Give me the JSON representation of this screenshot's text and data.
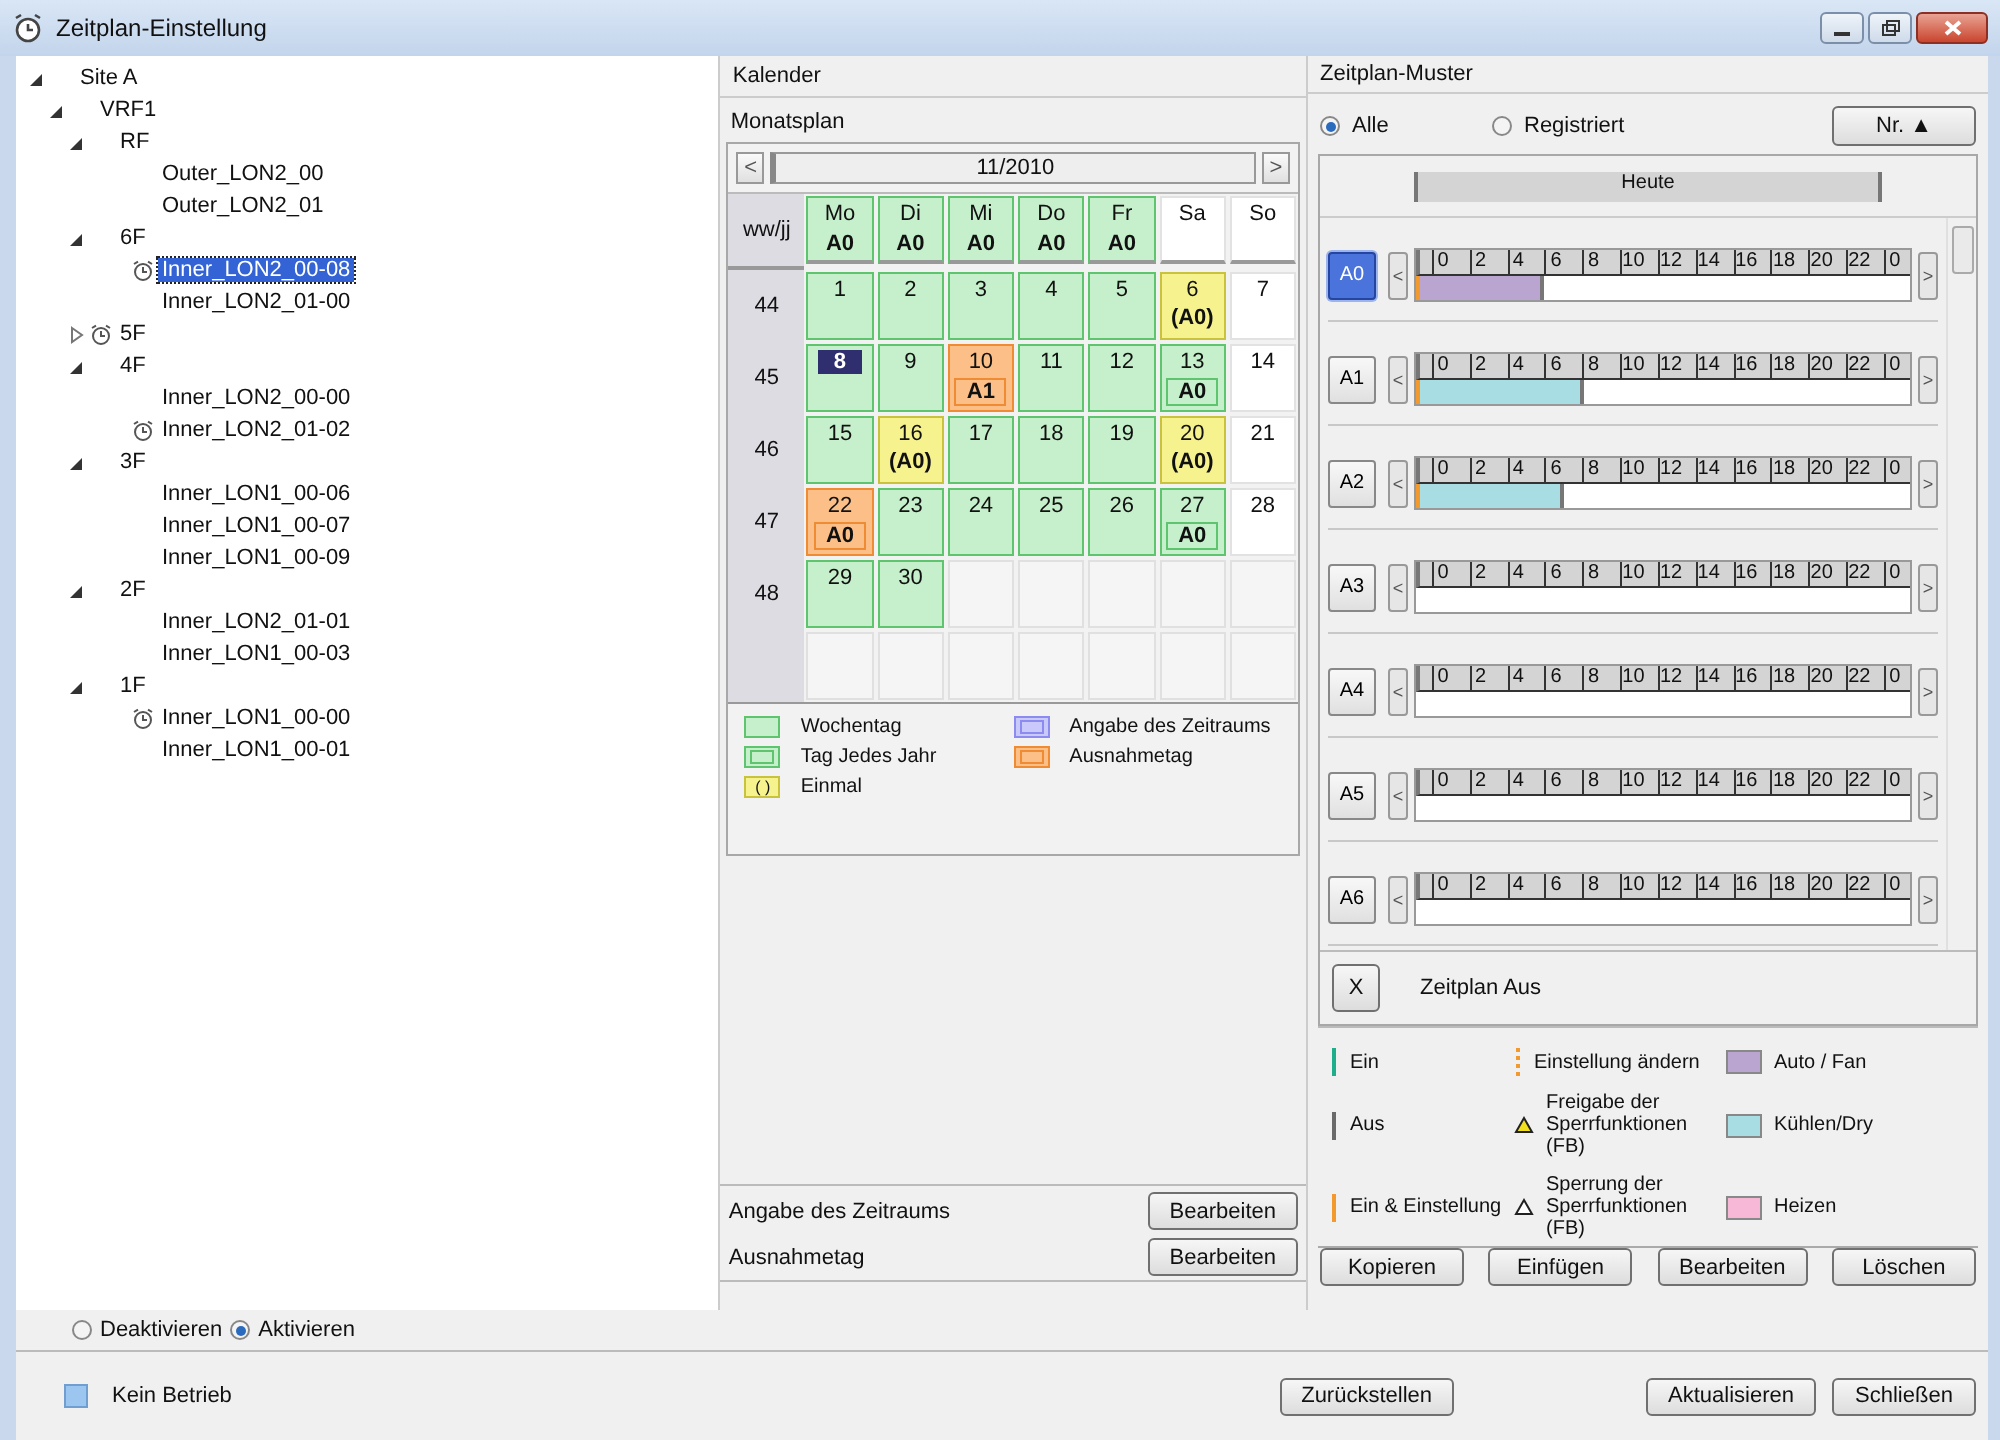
{
  "window": {
    "title": "Zeitplan-Einstellung"
  },
  "tree": [
    {
      "label": "Site A",
      "expanded": true,
      "schedule": false,
      "selected": false,
      "children": [
        {
          "label": "VRF1",
          "expanded": true,
          "schedule": false,
          "selected": false,
          "children": [
            {
              "label": "RF",
              "expanded": true,
              "schedule": false,
              "selected": false,
              "children": [
                {
                  "label": "Outer_LON2_00",
                  "schedule": false,
                  "selected": false
                },
                {
                  "label": "Outer_LON2_01",
                  "schedule": false,
                  "selected": false
                }
              ]
            },
            {
              "label": "6F",
              "expanded": true,
              "schedule": false,
              "selected": false,
              "children": [
                {
                  "label": "Inner_LON2_00-08",
                  "schedule": true,
                  "selected": true
                },
                {
                  "label": "Inner_LON2_01-00",
                  "schedule": false,
                  "selected": false
                }
              ]
            },
            {
              "label": "5F",
              "expanded": false,
              "schedule": true,
              "selected": false
            },
            {
              "label": "4F",
              "expanded": true,
              "schedule": false,
              "selected": false,
              "children": [
                {
                  "label": "Inner_LON2_00-00",
                  "schedule": false,
                  "selected": false
                },
                {
                  "label": "Inner_LON2_01-02",
                  "schedule": true,
                  "selected": false
                }
              ]
            },
            {
              "label": "3F",
              "expanded": true,
              "schedule": false,
              "selected": false,
              "children": [
                {
                  "label": "Inner_LON1_00-06",
                  "schedule": false,
                  "selected": false
                },
                {
                  "label": "Inner_LON1_00-07",
                  "schedule": false,
                  "selected": false
                },
                {
                  "label": "Inner_LON1_00-09",
                  "schedule": false,
                  "selected": false
                }
              ]
            },
            {
              "label": "2F",
              "expanded": true,
              "schedule": false,
              "selected": false,
              "children": [
                {
                  "label": "Inner_LON2_01-01",
                  "schedule": false,
                  "selected": false
                },
                {
                  "label": "Inner_LON1_00-03",
                  "schedule": false,
                  "selected": false
                }
              ]
            },
            {
              "label": "1F",
              "expanded": true,
              "schedule": false,
              "selected": false,
              "children": [
                {
                  "label": "Inner_LON1_00-00",
                  "schedule": true,
                  "selected": false
                },
                {
                  "label": "Inner_LON1_00-01",
                  "schedule": false,
                  "selected": false
                }
              ]
            }
          ]
        }
      ]
    }
  ],
  "activation": [
    {
      "label": "Deaktivieren",
      "selected": false
    },
    {
      "label": "Aktivieren",
      "selected": true
    }
  ],
  "calendar": {
    "title": "Kalender",
    "subtitle": "Monatsplan",
    "prev": "<",
    "month": "11/2010",
    "next": ">",
    "week_header": "ww/jj",
    "days": [
      {
        "label": "Mo",
        "pattern": "A0",
        "kind": "weekday"
      },
      {
        "label": "Di",
        "pattern": "A0",
        "kind": "weekday"
      },
      {
        "label": "Mi",
        "pattern": "A0",
        "kind": "weekday"
      },
      {
        "label": "Do",
        "pattern": "A0",
        "kind": "weekday"
      },
      {
        "label": "Fr",
        "pattern": "A0",
        "kind": "weekday"
      },
      {
        "label": "Sa",
        "kind": "plain"
      },
      {
        "label": "So",
        "kind": "plain"
      }
    ],
    "weeks": [
      {
        "number": "44",
        "cells": [
          {
            "day": "1",
            "kind": "weekday",
            "selected": false
          },
          {
            "day": "2",
            "kind": "weekday",
            "selected": false
          },
          {
            "day": "3",
            "kind": "weekday",
            "selected": false
          },
          {
            "day": "4",
            "kind": "weekday",
            "selected": false
          },
          {
            "day": "5",
            "kind": "weekday",
            "selected": false
          },
          {
            "day": "6",
            "pattern": "(A0)",
            "kind": "once",
            "selected": false
          },
          {
            "day": "7",
            "kind": "plain",
            "selected": false
          }
        ]
      },
      {
        "number": "45",
        "cells": [
          {
            "day": "8",
            "kind": "weekday",
            "selected": true
          },
          {
            "day": "9",
            "kind": "weekday",
            "selected": false
          },
          {
            "day": "10",
            "pattern": "A1",
            "kind": "exception",
            "selected": false
          },
          {
            "day": "11",
            "kind": "weekday",
            "selected": false
          },
          {
            "day": "12",
            "kind": "weekday",
            "selected": false
          },
          {
            "day": "13",
            "pattern": "A0",
            "kind": "yearly",
            "selected": false
          },
          {
            "day": "14",
            "kind": "plain",
            "selected": false
          }
        ]
      },
      {
        "number": "46",
        "cells": [
          {
            "day": "15",
            "kind": "weekday",
            "selected": false
          },
          {
            "day": "16",
            "pattern": "(A0)",
            "kind": "once",
            "selected": false
          },
          {
            "day": "17",
            "kind": "weekday",
            "selected": false
          },
          {
            "day": "18",
            "kind": "weekday",
            "selected": false
          },
          {
            "day": "19",
            "kind": "weekday",
            "selected": false
          },
          {
            "day": "20",
            "pattern": "(A0)",
            "kind": "once",
            "selected": false
          },
          {
            "day": "21",
            "kind": "plain",
            "selected": false
          }
        ]
      },
      {
        "number": "47",
        "cells": [
          {
            "day": "22",
            "pattern": "A0",
            "kind": "exception",
            "selected": false
          },
          {
            "day": "23",
            "kind": "weekday",
            "selected": false
          },
          {
            "day": "24",
            "kind": "weekday",
            "selected": false
          },
          {
            "day": "25",
            "kind": "weekday",
            "selected": false
          },
          {
            "day": "26",
            "kind": "weekday",
            "selected": false
          },
          {
            "day": "27",
            "pattern": "A0",
            "kind": "yearly",
            "selected": false
          },
          {
            "day": "28",
            "kind": "plain",
            "selected": false
          }
        ]
      },
      {
        "number": "48",
        "cells": [
          {
            "day": "29",
            "kind": "weekday",
            "selected": false
          },
          {
            "day": "30",
            "kind": "weekday",
            "selected": false
          },
          {
            "kind": "empty"
          },
          {
            "kind": "empty"
          },
          {
            "kind": "empty"
          },
          {
            "kind": "empty"
          },
          {
            "kind": "empty"
          }
        ]
      },
      {
        "cells": [
          {
            "kind": "empty"
          },
          {
            "kind": "empty"
          },
          {
            "kind": "empty"
          },
          {
            "kind": "empty"
          },
          {
            "kind": "empty"
          },
          {
            "kind": "empty"
          },
          {
            "kind": "empty"
          }
        ]
      }
    ],
    "legend": [
      {
        "label": "Wochentag",
        "kind": "weekday"
      },
      {
        "label": "Angabe des Zeitraums",
        "kind": "period"
      },
      {
        "label": "Tag Jedes Jahr",
        "kind": "yearly"
      },
      {
        "label": "Ausnahmetag",
        "kind": "exception"
      },
      {
        "label": "Einmal",
        "kind": "once",
        "symbol": "( )"
      }
    ],
    "footer": [
      {
        "label": "Angabe des Zeitraums",
        "button": "Bearbeiten"
      },
      {
        "label": "Ausnahmetag",
        "button": "Bearbeiten"
      }
    ]
  },
  "patterns": {
    "title": "Zeitplan-Muster",
    "filters": [
      {
        "label": "Alle",
        "selected": true
      },
      {
        "label": "Registriert",
        "selected": false
      }
    ],
    "sort_button": "Nr. ▲",
    "today_label": "Heute",
    "rows": [
      {
        "name": "A0",
        "selected": true,
        "prev": "<",
        "next": ">",
        "start_marker": true,
        "color": "#b9a5cf",
        "level": 0.25,
        "ticks": [
          "0",
          "2",
          "4",
          "6",
          "8",
          "10",
          "12",
          "14",
          "16",
          "18",
          "20",
          "22",
          "0"
        ]
      },
      {
        "name": "A1",
        "selected": false,
        "prev": "<",
        "next": ">",
        "start_marker": true,
        "color": "#a8dde3",
        "level": 0.333,
        "ticks": [
          "0",
          "2",
          "4",
          "6",
          "8",
          "10",
          "12",
          "14",
          "16",
          "18",
          "20",
          "22",
          "0"
        ]
      },
      {
        "name": "A2",
        "selected": false,
        "prev": "<",
        "next": ">",
        "start_marker": true,
        "color": "#a8dde3",
        "level": 0.292,
        "ticks": [
          "0",
          "2",
          "4",
          "6",
          "8",
          "10",
          "12",
          "14",
          "16",
          "18",
          "20",
          "22",
          "0"
        ]
      },
      {
        "name": "A3",
        "selected": false,
        "prev": "<",
        "next": ">",
        "start_marker": false,
        "ticks": [
          "0",
          "2",
          "4",
          "6",
          "8",
          "10",
          "12",
          "14",
          "16",
          "18",
          "20",
          "22",
          "0"
        ]
      },
      {
        "name": "A4",
        "selected": false,
        "prev": "<",
        "next": ">",
        "start_marker": false,
        "ticks": [
          "0",
          "2",
          "4",
          "6",
          "8",
          "10",
          "12",
          "14",
          "16",
          "18",
          "20",
          "22",
          "0"
        ]
      },
      {
        "name": "A5",
        "selected": false,
        "prev": "<",
        "next": ">",
        "start_marker": false,
        "ticks": [
          "0",
          "2",
          "4",
          "6",
          "8",
          "10",
          "12",
          "14",
          "16",
          "18",
          "20",
          "22",
          "0"
        ]
      },
      {
        "name": "A6",
        "selected": false,
        "prev": "<",
        "next": ">",
        "start_marker": false,
        "ticks": [
          "0",
          "2",
          "4",
          "6",
          "8",
          "10",
          "12",
          "14",
          "16",
          "18",
          "20",
          "22",
          "0"
        ]
      }
    ],
    "off_button": "X",
    "off_label": "Zeitplan Aus",
    "legend": [
      {
        "label": "Ein",
        "kind": "line",
        "color": "#1fae8c"
      },
      {
        "label": "Einstellung ändern",
        "kind": "dotted",
        "color": "#f29a2e"
      },
      {
        "label": "Auto / Fan",
        "kind": "swatch",
        "color": "#b9a5cf"
      },
      {
        "label": "Aus",
        "kind": "line",
        "color": "#6a6a6a"
      },
      {
        "label": "Freigabe der Sperrfunktionen (FB)",
        "kind": "triangle",
        "color": "#f0e020"
      },
      {
        "label": "Kühlen/Dry",
        "kind": "swatch",
        "color": "#a8dde3"
      },
      {
        "label": "Ein & Einstellung",
        "kind": "line",
        "color": "#f29a2e"
      },
      {
        "label": "Sperrung der Sperrfunktionen (FB)",
        "kind": "triangle",
        "color": "#ffffff"
      },
      {
        "label": "Heizen",
        "kind": "swatch",
        "color": "#f7b8d8"
      }
    ],
    "buttons": [
      "Kopieren",
      "Einfügen",
      "Bearbeiten",
      "Löschen"
    ]
  },
  "status": {
    "label": "Kein Betrieb"
  },
  "bottom_buttons": [
    "Zurückstellen",
    "Aktualisieren",
    "Schließen"
  ]
}
